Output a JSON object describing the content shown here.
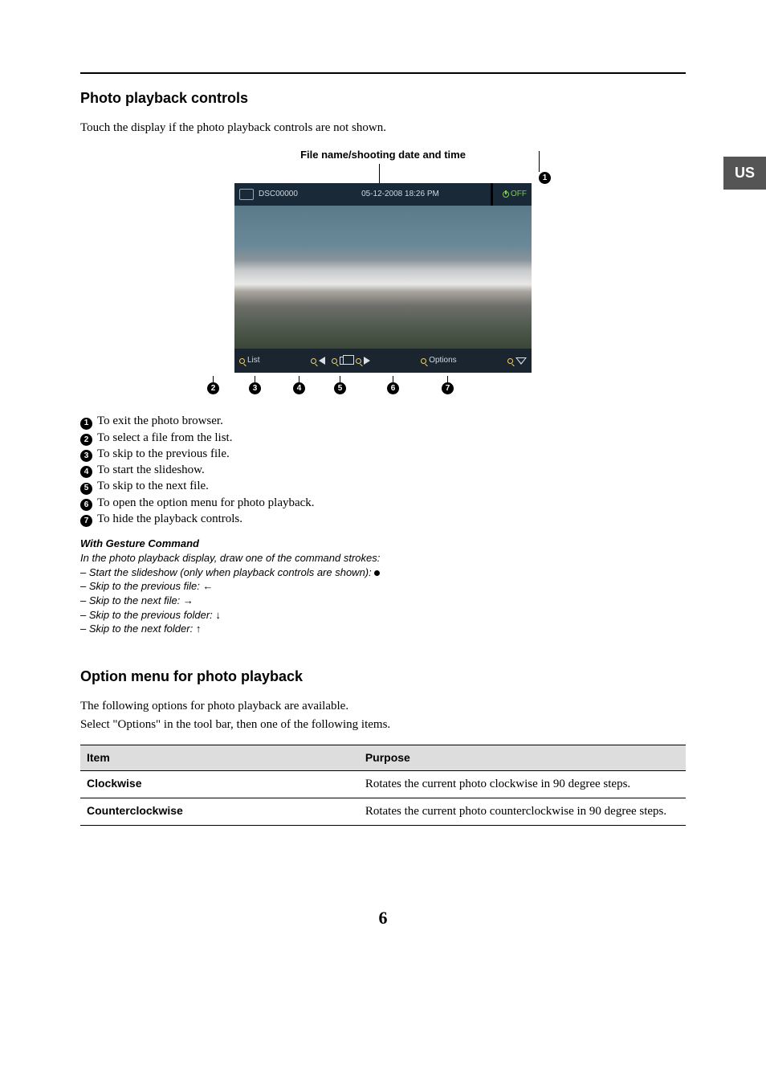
{
  "lang_tab": "US",
  "section1": {
    "title": "Photo playback controls",
    "intro": "Touch the display if the photo playback controls are not shown.",
    "caption": "File name/shooting date and time"
  },
  "screenshot": {
    "file_name": "DSC00000",
    "date_time": "05-12-2008 18:26 PM",
    "off": "OFF",
    "list": "List",
    "options": "Options"
  },
  "legend": [
    "To exit the photo browser.",
    "To select a file from the list.",
    "To skip to the previous file.",
    "To start the slideshow.",
    "To skip to the next file.",
    "To open the option menu for photo playback.",
    "To hide the playback controls."
  ],
  "gesture": {
    "title": "With Gesture Command",
    "intro": "In the photo playback display, draw one of the command strokes:",
    "items": [
      "– Start the slideshow (only when playback controls are shown): ",
      "– Skip to the previous file: ",
      "– Skip to the next file: ",
      "– Skip to the previous folder: ",
      "– Skip to the next folder: "
    ],
    "symbols": [
      "●",
      "←",
      "→",
      "↓",
      "↑"
    ]
  },
  "section2": {
    "title": "Option menu for photo playback",
    "intro1": "The following options for photo playback are available.",
    "intro2": "Select \"Options\" in the tool bar, then one of the following items."
  },
  "table": {
    "head": [
      "Item",
      "Purpose"
    ],
    "rows": [
      {
        "item": "Clockwise",
        "purpose": "Rotates the current photo clockwise in 90 degree steps."
      },
      {
        "item": "Counterclockwise",
        "purpose": "Rotates the current photo counterclockwise in 90 degree steps."
      }
    ]
  },
  "page_number": "6"
}
